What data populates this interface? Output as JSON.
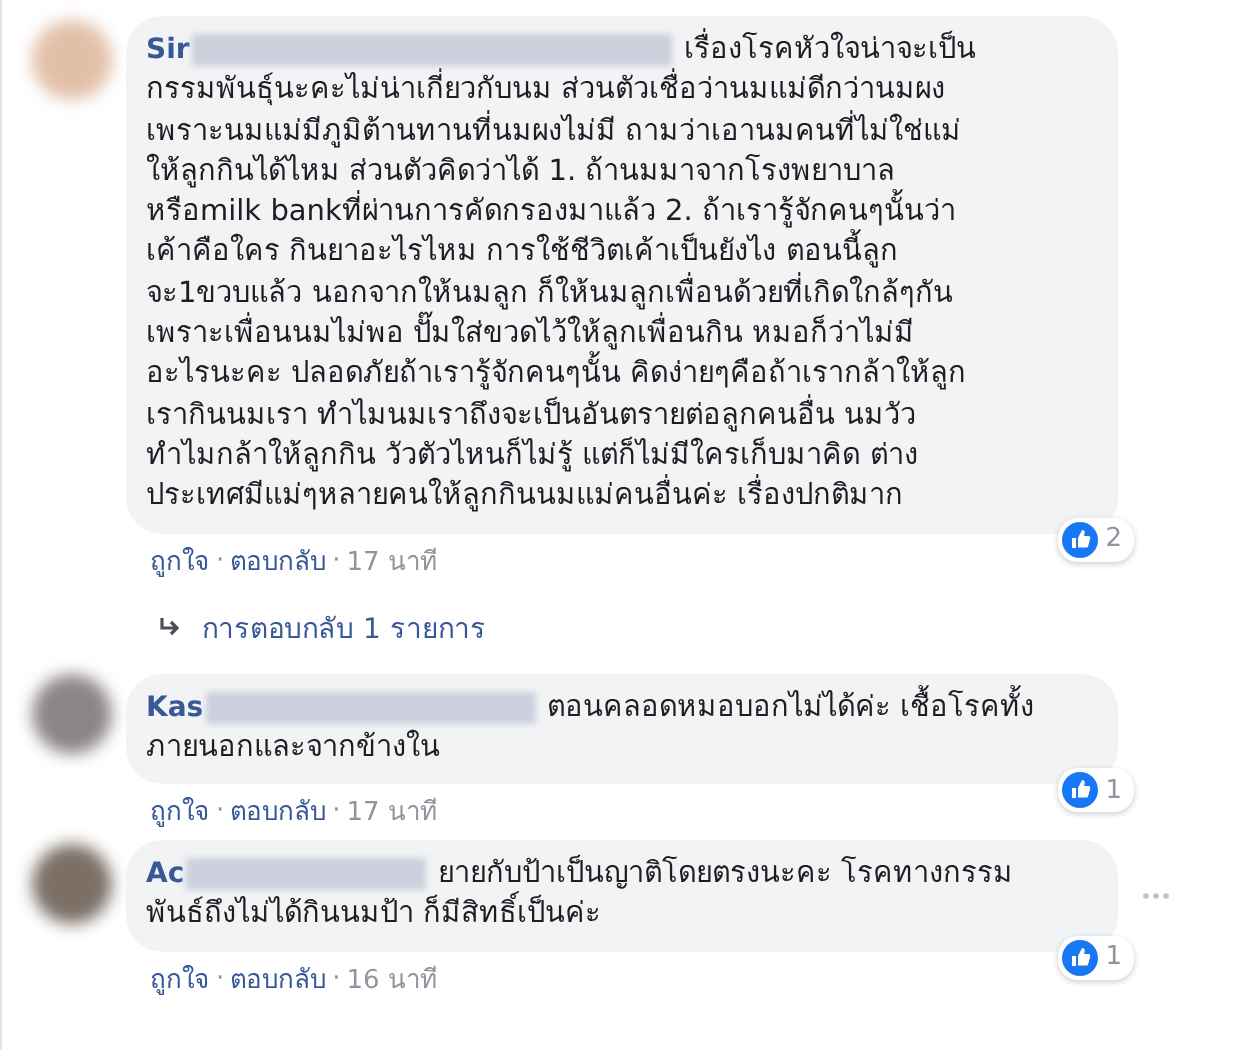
{
  "comments": [
    {
      "name": "Sir",
      "text": "เรื่องโรคหัวใจน่าจะเป็น\nกรรมพันธุ์นะคะไม่น่าเกี่ยวกับนม ส่วนตัวเชื่อว่านมแม่ดีกว่านมผง\nเพราะนมแม่มีภูมิต้านทานที่นมผงไม่มี ถามว่าเอานมคนที่ไม่ใช่แม่\nให้ลูกกินได้ไหม ส่วนตัวคิดว่าได้ 1. ถ้านมมาจากโรงพยาบาล\nหรือmilk bankที่ผ่านการคัดกรองมาแล้ว 2. ถ้าเรารู้จักคนๆนั้นว่า\nเค้าคือใคร กินยาอะไรไหม การใช้ชีวิตเค้าเป็นยังไง ตอนนี้ลูก\nจะ1ขวบแล้ว นอกจากให้นมลูก ก็ให้นมลูกเพื่อนด้วยที่เกิดใกล้ๆกัน\nเพราะเพื่อนนมไม่พอ ปั๊มใส่ขวดไว้ให้ลูกเพื่อนกิน หมอก็ว่าไม่มี\nอะไรนะคะ ปลอดภัยถ้าเรารู้จักคนๆนั้น คิดง่ายๆคือถ้าเรากล้าให้ลูก\nเรากินนมเรา ทำไมนมเราถึงจะเป็นอันตรายต่อลูกคนอื่น นมวัว\nทำไมกล้าให้ลูกกิน วัวตัวไหนก็ไม่รู้ แต่ก็ไม่มีใครเก็บมาคิด ต่าง\nประเทศมีแม่ๆหลายคนให้ลูกกินนมแม่คนอื่นค่ะ เรื่องปกติมาก",
      "likes": "2",
      "actions": [
        "ถูกใจ",
        "ตอบกลับ"
      ],
      "time": "17 นาที",
      "sep": "·",
      "replies": "การตอบกลับ 1 รายการ",
      "more": false
    },
    {
      "name": "Kas",
      "text": "ตอนคลอดหมอบอกไม่ได้ค่ะ เชื้อโรคทั้ง\nภายนอกและจากข้างใน",
      "likes": "1",
      "actions": [
        "ถูกใจ",
        "ตอบกลับ"
      ],
      "time": "17 นาที",
      "sep": "·",
      "more": false
    },
    {
      "name": "Ac",
      "text": "ยายกับป้าเป็นญาติโดยตรงนะคะ โรคทางกรรม\nพันธ์ถึงไม่ได้กินนมป้า ก็มีสิทธิ์เป็นค่ะ",
      "likes": "1",
      "actions": [
        "ถูกใจ",
        "ตอบกลับ"
      ],
      "time": "16 นาที",
      "sep": "·",
      "more": true
    }
  ]
}
